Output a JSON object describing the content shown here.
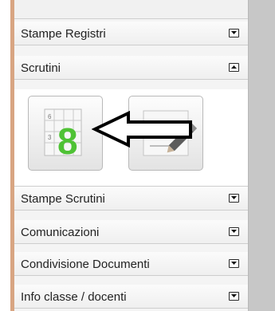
{
  "menu": {
    "sections": [
      {
        "label": "Stampe Registri",
        "state": "collapsed"
      },
      {
        "label": "Scrutini",
        "state": "expanded"
      },
      {
        "label": "Stampe Scrutini",
        "state": "collapsed"
      },
      {
        "label": "Comunicazioni",
        "state": "collapsed"
      },
      {
        "label": "Condivisione Documenti",
        "state": "collapsed"
      },
      {
        "label": "Info classe / docenti",
        "state": "collapsed"
      }
    ],
    "scrutini_tools": [
      {
        "icon": "grade-sheet-icon",
        "digits": [
          "6",
          "3",
          "8"
        ]
      },
      {
        "icon": "edit-notes-icon"
      }
    ]
  },
  "colors": {
    "accent_strip": "#d8a582",
    "grade_green": "#4fc235",
    "annotation_arrow": "#000000"
  }
}
